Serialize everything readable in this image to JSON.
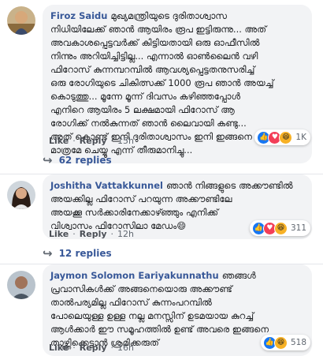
{
  "comments": [
    {
      "author": "Firoz Saidu",
      "text": "മുഖ്യമന്ത്രിയുടെ ദുരിതാശ്വാസ\nനിധിയിലേക്ക് ഞാൻ ആയിരം രൂപ ഇട്ടിരുന്നു... അത്\nഅവകാശപ്പെട്ടവർക്ക് കിട്ടിയതായി ഒരു ഓഫീസിൽ\nനിന്നും അറിയിച്ചിട്ടില്ല... എന്നാൽ ഓൺലൈൻ വഴി\nഫിറോസ് കുന്നമ്പറമ്പിൽ ആവശ്യപ്പെട്ടതനുസരിച്ച്\nഒരു രോഗിയുടെ ചികിത്സക്ക് 1000 രൂപ ഞാൻ അയച്ച്\nകൊടുത്തു... മൂന്നേ മൂന്ന് ദിവസം കഴിഞ്ഞപ്പോൾ\nഎനിറെ ആയിരം 5 ലക്ഷമായി ഫിറോസ് ആ\nരോഗിക്ക് നൽകുന്നത് ഞാൻ ലൈവായി കണ്ടു...\nഅത് കൊണ്ട് ഇനി ദുരിതാശ്വാസം ഇനി ഇങ്ങനെ\nമാത്രമേ ചെയ്യൂ എന്ന് തീരുമാനിച്ചു...",
      "like": "Like",
      "reply": "Reply",
      "time": "15h",
      "reaction_count": "1K",
      "reaction_icons": [
        "like-icon",
        "love-icon",
        "haha-icon"
      ],
      "replies_label": "62 replies"
    },
    {
      "author": "Joshitha Vattakkunnel",
      "text": "ഞാൻ നിങ്ങളുടെ അക്കൗണ്ടിൽ\nഅയക്കില്ല ഫിറോസ് പറയുന്ന അക്കൗണ്ടിലേ\nഅയക്കൂ സർക്കാരിനേക്കാഴ്ഞ്ഞും എനിക്ക്\nവിശ്വാസം ഫിറോസിലാ മേഡം😄",
      "like": "Like",
      "reply": "Reply",
      "time": "12h",
      "reaction_count": "311",
      "reaction_icons": [
        "like-icon",
        "love-icon",
        "haha-icon"
      ],
      "replies_label": "12 replies"
    },
    {
      "author": "Jaymon Solomon Eariyakunnathu",
      "text": "ഞങ്ങൾ\nപ്രവാസികൾക്ക് അങ്ങനെയൊരു അക്കൗണ്ട്\nതാൽപര്യമില്ല ഫിറോസ് കുന്നംപറമ്പിൽ\nപോലെയുള്ള ഉള്ള നല്ല മനസ്സിന് ഉടമയായ കുറച്ച്\nആൾക്കാർ ഈ സമൂഹത്തിൽ ഉണ്ട് അവരെ ഇങ്ങനെ\nതാഴ്ത്തിക്കെട്ടാൻ ശ്രമിക്കരുത്",
      "like": "Like",
      "reply": "Reply",
      "time": "16h",
      "reaction_count": "518",
      "reaction_icons": [
        "like-icon",
        "haha-icon"
      ]
    }
  ],
  "colors": {
    "author": "#385898",
    "bubble": "#f2f3f5",
    "meta": "#606770",
    "like": "#1877f2",
    "love": "#f33e58",
    "haha": "#f7b125"
  }
}
